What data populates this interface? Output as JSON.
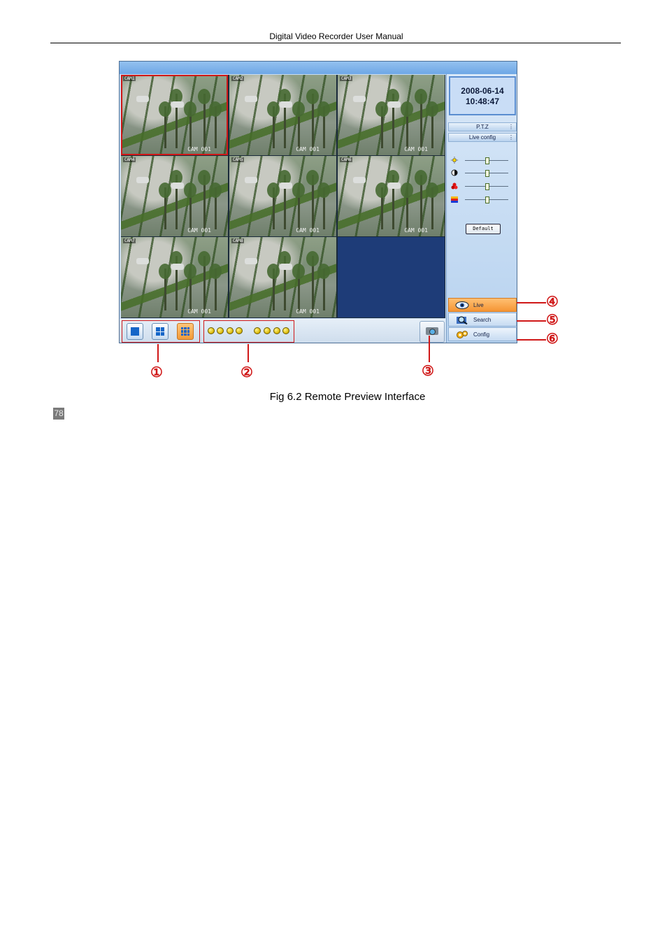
{
  "header": {
    "title": "Digital Video Recorder User Manual"
  },
  "figure": {
    "cameras": [
      {
        "tag": "CAM1",
        "label": "CAM 001",
        "selected": true
      },
      {
        "tag": "CAM2",
        "label": "CAM 001"
      },
      {
        "tag": "CAM3",
        "label": "CAM 001"
      },
      {
        "tag": "CAM4",
        "label": "CAM 001"
      },
      {
        "tag": "CAM5",
        "label": "CAM 001"
      },
      {
        "tag": "CAM6",
        "label": "CAM 001"
      },
      {
        "tag": "CAM7",
        "label": "CAM 001"
      },
      {
        "tag": "CAM8",
        "label": "CAM 001"
      }
    ],
    "panel": {
      "date": "2008-06-14",
      "time": "10:48:47",
      "ptz_label": "P.T.Z",
      "live_config_label": "Live config",
      "default_label": "Default",
      "sliders": [
        {
          "icon": "brightness-icon",
          "level": 0.5
        },
        {
          "icon": "contrast-icon",
          "level": 0.5
        },
        {
          "icon": "saturation-icon",
          "level": 0.5
        },
        {
          "icon": "hue-icon",
          "level": 0.5
        }
      ],
      "nav": [
        {
          "label": "Live",
          "icon": "eye-icon",
          "active": true
        },
        {
          "label": "Search",
          "icon": "magnifier-icon"
        },
        {
          "label": "Config",
          "icon": "gear-icon"
        }
      ]
    },
    "toolbar": {
      "layouts": [
        "1x1",
        "2x2",
        "3x3"
      ],
      "active_layout": "3x3",
      "channel_dots": 8
    },
    "callouts": [
      "①",
      "②",
      "③",
      "④",
      "⑤",
      "⑥"
    ]
  },
  "caption": "Fig 6.2 Remote Preview Interface",
  "page_number": "78",
  "colors": {
    "accent_red": "#d01818",
    "panel_blue": "#c9ddf3",
    "active_orange": "#f59534"
  }
}
